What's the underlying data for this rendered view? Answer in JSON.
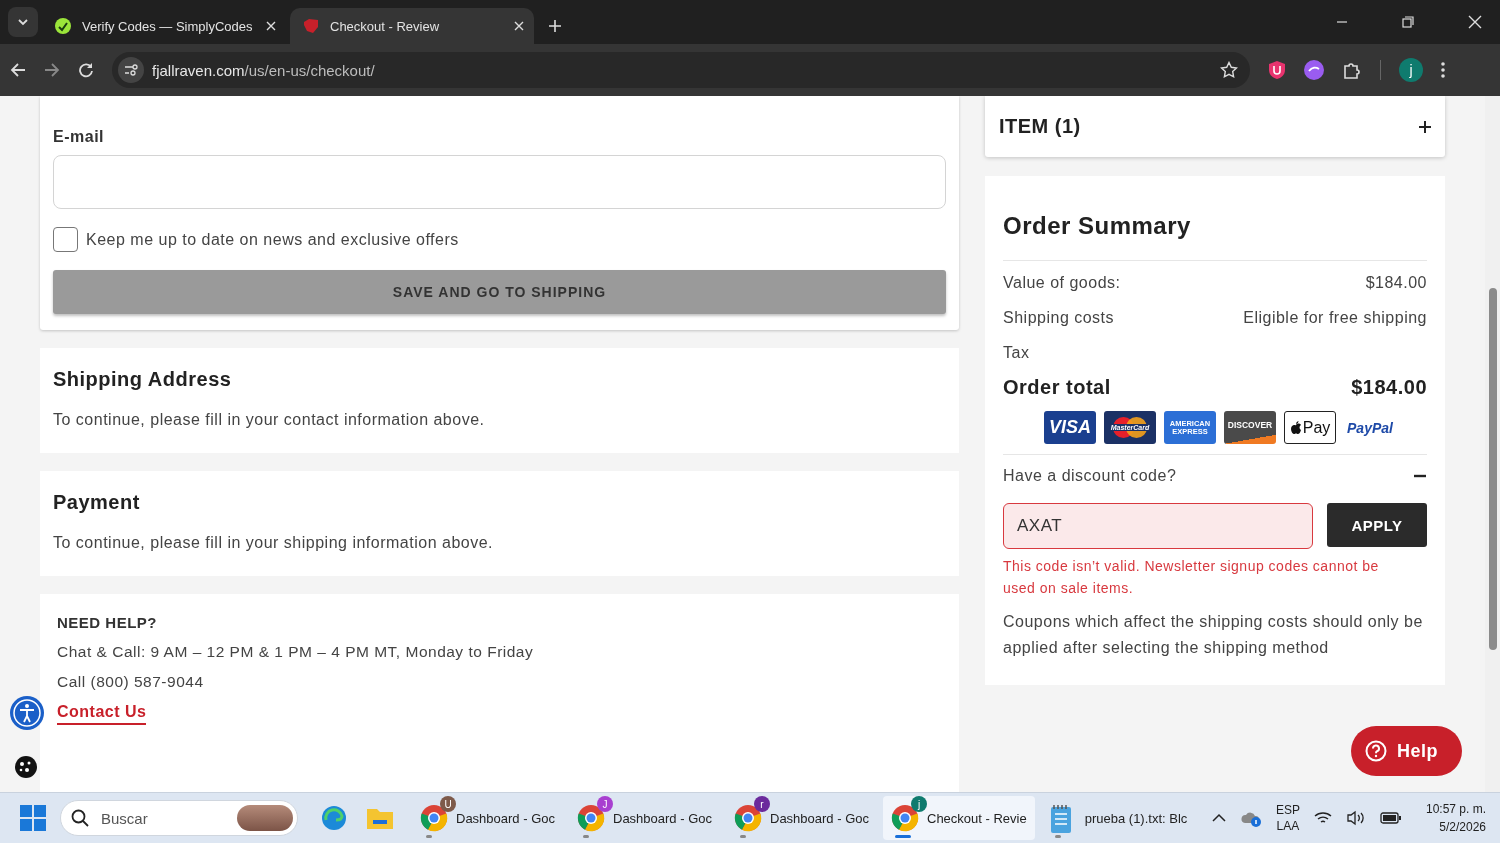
{
  "browser": {
    "tabs": [
      {
        "title": "Verify Codes — SimplyCodes",
        "selected": false,
        "kind": "simplycodes"
      },
      {
        "title": "Checkout - Review",
        "selected": true,
        "kind": "fox"
      }
    ],
    "url": {
      "host": "fjallraven.com",
      "path": "/us/en-us/checkout/"
    },
    "profile": "j"
  },
  "contact": {
    "email": {
      "label": "E-mail"
    },
    "newsletter": {
      "label": "Keep me up to date on news and exclusive offers",
      "checked": false
    },
    "save_button": {
      "label": "SAVE AND GO TO SHIPPING",
      "disabled": true
    }
  },
  "sections": [
    {
      "title": "Shipping Address",
      "text": "To continue, please fill in your contact information above."
    },
    {
      "title": "Payment",
      "text": "To continue, please fill in your shipping information above."
    }
  ],
  "help": {
    "title": "NEED HELP?",
    "hours": "Chat & Call: 9 AM – 12 PM & 1 PM – 4 PM MT, Monday to Friday",
    "phone": "Call (800) 587-9044",
    "link": "Contact Us"
  },
  "items": {
    "label": "ITEM (1)",
    "expanded": false
  },
  "summary": {
    "title": "Order Summary",
    "rows": [
      {
        "label": "Value of goods:",
        "value": "$184.00"
      },
      {
        "label": "Shipping costs",
        "value": "Eligible for free shipping"
      },
      {
        "label": "Tax"
      }
    ],
    "total": {
      "label": "Order total",
      "value": "$184.00"
    },
    "payment_methods": [
      {
        "kind": "visa",
        "label": "VISA"
      },
      {
        "kind": "mastercard",
        "label": "MasterCard"
      },
      {
        "kind": "amex",
        "label": "AMERICAN EXPRESS"
      },
      {
        "kind": "discover",
        "label": "DISCOVER"
      },
      {
        "kind": "applepay",
        "label": "Pay"
      },
      {
        "kind": "paypal",
        "label": "PayPal"
      }
    ],
    "discount": {
      "label": "Have a discount code?",
      "expanded": true,
      "value": "AXAT",
      "invalid": true,
      "button": "APPLY",
      "error": "This code isn’t valid. Newsletter signup codes cannot be used on sale items.",
      "note": "Coupons which affect the shipping costs should only be applied after selecting the shipping method"
    }
  },
  "help_button": {
    "label": "Help"
  },
  "taskbar": {
    "search": {
      "placeholder": "Buscar"
    },
    "apps": [
      {
        "kind": "edge"
      },
      {
        "kind": "files"
      },
      {
        "kind": "chrome",
        "label": "Dashboard - Goc",
        "badge": "U",
        "color": "#7d5a4a",
        "selected": false
      },
      {
        "kind": "chrome",
        "label": "Dashboard - Goc",
        "badge": "J",
        "color": "#a83fd0",
        "selected": false
      },
      {
        "kind": "chrome",
        "label": "Dashboard - Goc",
        "badge": "r",
        "color": "#6b2a9c",
        "selected": false
      },
      {
        "kind": "chrome",
        "label": "Checkout - Revie",
        "badge": "j",
        "color": "#0f7b6e",
        "selected": true
      },
      {
        "kind": "notepad",
        "label": "prueba (1).txt: Blc",
        "selected": false
      }
    ],
    "tray": {
      "language": "ESP",
      "layout": "LAA",
      "time": "10:57 p. m.",
      "date": "5/2/2026"
    }
  }
}
